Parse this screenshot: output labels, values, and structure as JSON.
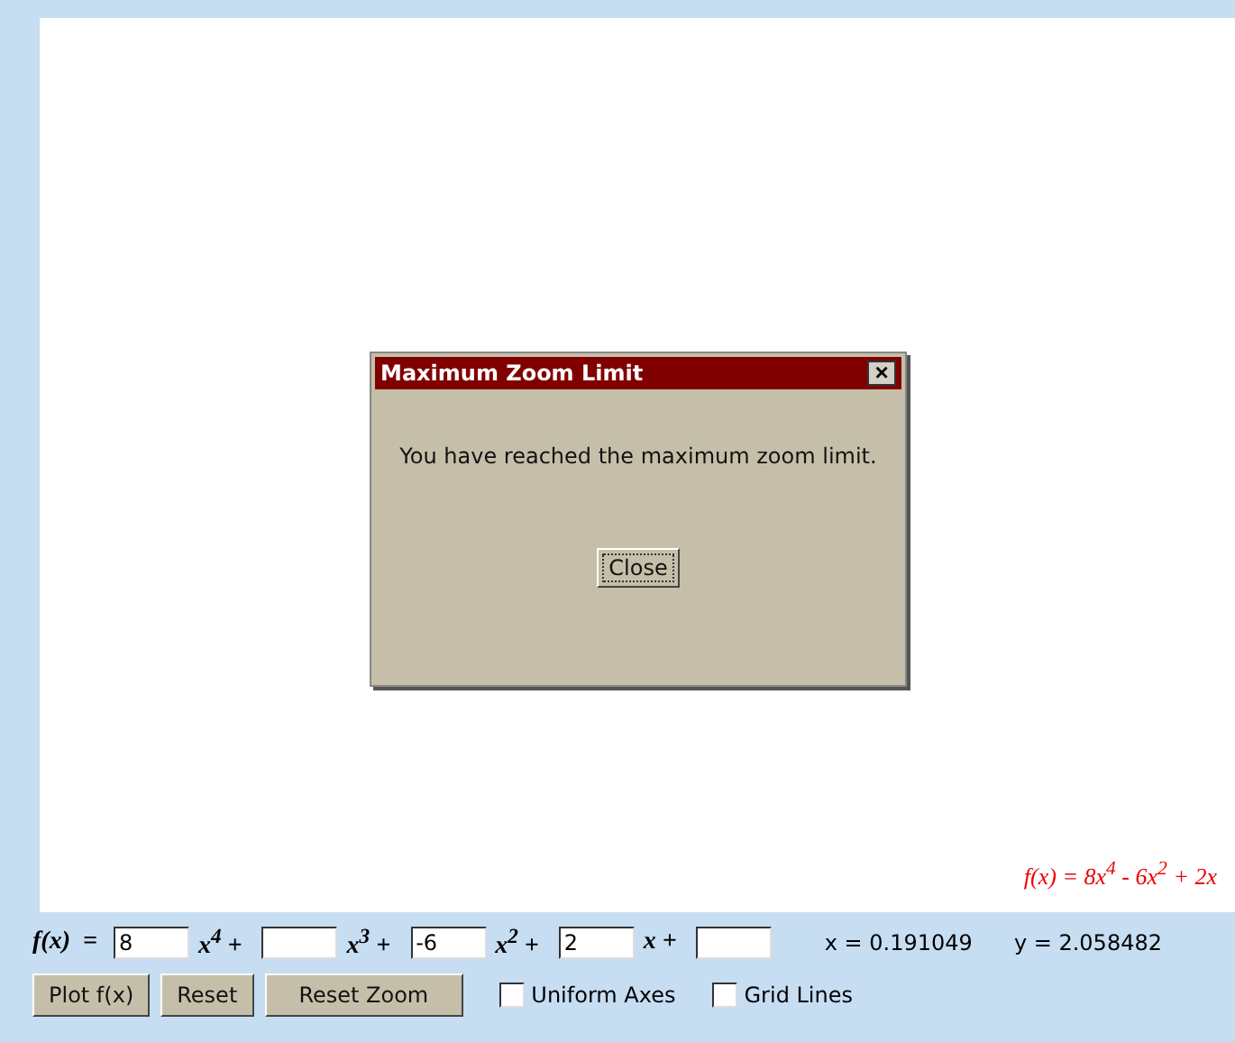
{
  "plot": {
    "formula": "f(x) = 8x$^{4}$ - 6x$^{2}$ + 2x"
  },
  "dialog": {
    "title": "Maximum Zoom Limit",
    "close_icon": "×",
    "message": "You have reached the maximum zoom limit.",
    "button": "Close"
  },
  "equation": {
    "lhs": "f(x)  =",
    "fields": [
      {
        "kind": "coefficient",
        "value": "8",
        "suffix": "x$^{4}$ +"
      },
      {
        "kind": "coefficient",
        "suffix": "x$^{3}$ +"
      },
      {
        "kind": "coefficient",
        "value": "-6",
        "suffix": "x$^{2}$ +"
      },
      {
        "kind": "coefficient",
        "value": "2",
        "suffix": "x +"
      },
      {
        "kind": "constant"
      }
    ],
    "readouts": [
      "x = 0.191049",
      "y = 2.058482"
    ]
  },
  "buttons": [
    "Plot f(x)",
    "Reset",
    "Reset Zoom"
  ],
  "options": [
    {
      "label": "Uniform Axes",
      "checked": false
    },
    {
      "label": "Grid Lines",
      "checked": false
    }
  ]
}
